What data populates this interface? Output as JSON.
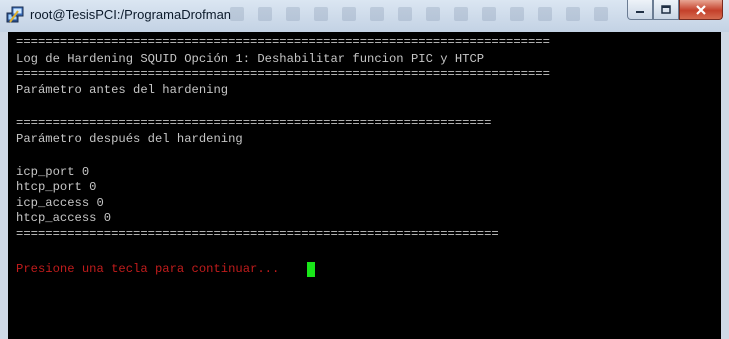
{
  "window": {
    "title": "root@TesisPCI:/ProgramaDrofman",
    "app_icon": "putty-icon",
    "controls": [
      "minimize-icon",
      "maximize-icon",
      "close-icon"
    ]
  },
  "terminal": {
    "sep1": "=========================================================================",
    "log_title": "Log de Hardening SQUID Opción 1: Deshabilitar funcion PIC y HTCP",
    "sep2": "=========================================================================",
    "before": "Parámetro antes del hardening",
    "sep3": "=================================================================",
    "after": "Parámetro después del hardening",
    "params": [
      "icp_port 0",
      "htcp_port 0",
      "icp_access 0",
      "htcp_access 0"
    ],
    "sep4": "==================================================================",
    "prompt": "Presione una tecla para continuar...",
    "colors": {
      "background": "#000000",
      "text": "#c6c6c6",
      "prompt": "#c01c1c",
      "cursor": "#19e619"
    }
  }
}
